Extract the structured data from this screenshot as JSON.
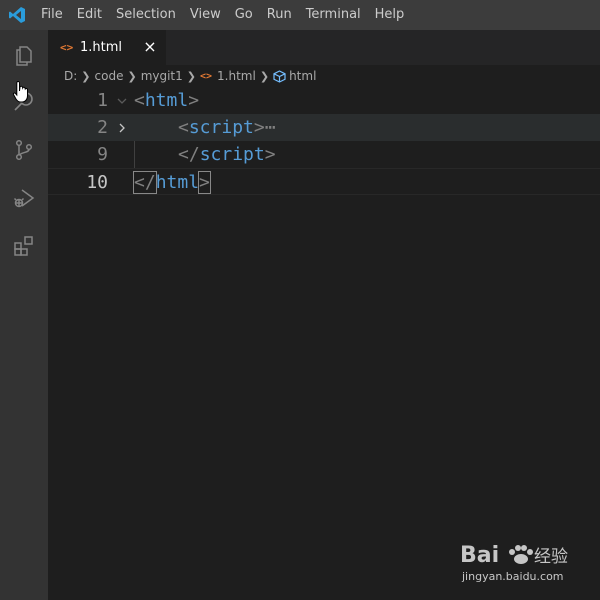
{
  "menu": [
    "File",
    "Edit",
    "Selection",
    "View",
    "Go",
    "Run",
    "Terminal",
    "Help"
  ],
  "activity_icons": [
    "explorer-icon",
    "search-icon",
    "source-control-icon",
    "run-debug-icon",
    "extensions-icon"
  ],
  "tab": {
    "label": "1.html",
    "close": "×",
    "icon": "<>"
  },
  "breadcrumb": [
    "D:",
    "code",
    "mygit1",
    "1.html",
    "html"
  ],
  "editor": {
    "lines": [
      {
        "number": "1",
        "open": "<",
        "tag": "html",
        "close": ">"
      },
      {
        "number": "2",
        "open": "<",
        "tag": "script",
        "close": ">",
        "ellipsis": "⋯"
      },
      {
        "number": "9",
        "open": "</",
        "tag": "script",
        "close": ">"
      },
      {
        "number": "10",
        "open": "</",
        "tag": "html",
        "close": ">"
      }
    ]
  },
  "colors": {
    "accent": "#007acc",
    "tag": "#569cd6",
    "bracket": "#808080"
  }
}
